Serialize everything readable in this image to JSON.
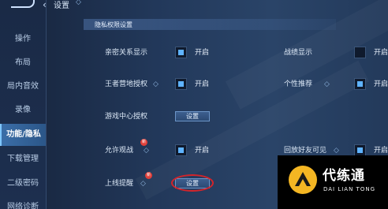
{
  "header": {
    "back_icon": "back-arrow-icon",
    "title": "设置",
    "help_icon": "diamond-help-icon"
  },
  "sidebar": {
    "items": [
      {
        "label": "操作",
        "active": false
      },
      {
        "label": "布局",
        "active": false
      },
      {
        "label": "局内音效",
        "active": false
      },
      {
        "label": "录像",
        "active": false
      },
      {
        "label": "功能/隐私",
        "active": true
      },
      {
        "label": "下载管理",
        "active": false
      },
      {
        "label": "二级密码",
        "active": false
      },
      {
        "label": "网络诊断",
        "active": false
      }
    ]
  },
  "section": {
    "title": "隐私权限设置"
  },
  "settings": {
    "intimacy": {
      "label": "亲密关系显示",
      "checked": true,
      "state": "开启"
    },
    "record": {
      "label": "战绩显示",
      "checked": false,
      "state": "开启"
    },
    "camp": {
      "label": "王者营地授权",
      "checked": true,
      "state": "开启"
    },
    "personal": {
      "label": "个性推荐",
      "checked": true,
      "state": "开启"
    },
    "gamecenter": {
      "label": "游戏中心授权",
      "button": "设置"
    },
    "spectate": {
      "label": "允许观战",
      "checked": true,
      "state": "开启",
      "badge": "新"
    },
    "replay": {
      "label": "回放好友可见",
      "checked": true,
      "state": "开启"
    },
    "online": {
      "label": "上线提醒",
      "button": "设置",
      "badge": "新"
    }
  },
  "watermark": {
    "brand": "代练通",
    "sub": "DAI LIAN TONG"
  },
  "colors": {
    "accent": "#5fb3ff",
    "highlight_ring": "#d3242a",
    "badge": "#e0403a"
  }
}
